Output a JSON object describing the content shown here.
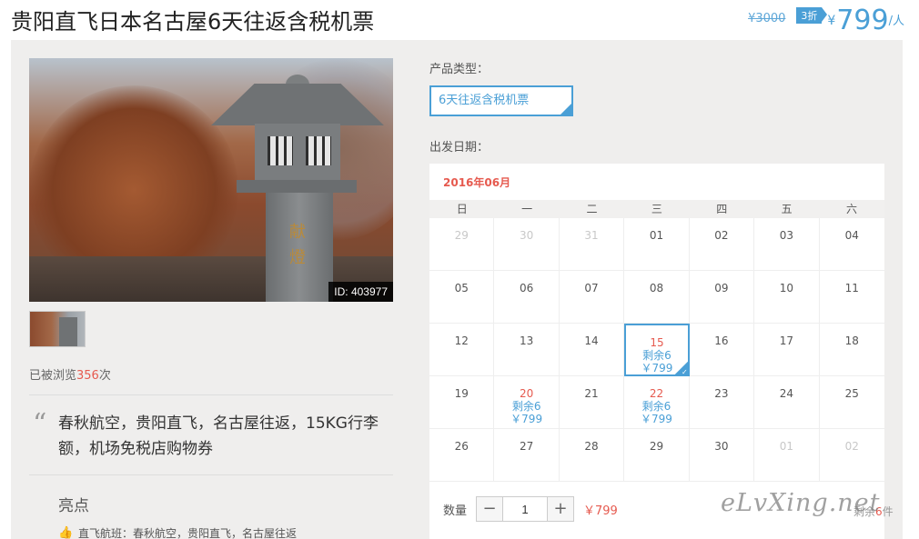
{
  "header": {
    "title": "贵阳直飞日本名古屋6天往返含税机票",
    "old_price": "¥3000",
    "discount": "3折",
    "currency": "¥",
    "price": "799",
    "per_person": "/人"
  },
  "gallery": {
    "photo_id": "ID: 403977",
    "kanji": "献燈"
  },
  "views": {
    "prefix": "已被浏览",
    "count": "356",
    "suffix": "次"
  },
  "quote": {
    "mark": "“",
    "text": "春秋航空，贵阳直飞，名古屋往返，15KG行李额，机场免税店购物券"
  },
  "highlights": {
    "title": "亮点",
    "item": "直飞航班：春秋航空，贵阳直飞，名古屋往返"
  },
  "product": {
    "type_label": "产品类型：",
    "type_value": "6天往返含税机票"
  },
  "calendar": {
    "date_label": "出发日期：",
    "month": "2016年06月",
    "weekdays": [
      "日",
      "一",
      "二",
      "三",
      "四",
      "五",
      "六"
    ],
    "days": [
      {
        "d": "29",
        "other": true
      },
      {
        "d": "30",
        "other": true
      },
      {
        "d": "31",
        "other": true
      },
      {
        "d": "01"
      },
      {
        "d": "02"
      },
      {
        "d": "03"
      },
      {
        "d": "04"
      },
      {
        "d": "05"
      },
      {
        "d": "06"
      },
      {
        "d": "07"
      },
      {
        "d": "08"
      },
      {
        "d": "09"
      },
      {
        "d": "10"
      },
      {
        "d": "11"
      },
      {
        "d": "12"
      },
      {
        "d": "13"
      },
      {
        "d": "14"
      },
      {
        "d": "15",
        "avail": true,
        "selected": true,
        "remain": "剩余6",
        "price": "￥799"
      },
      {
        "d": "16"
      },
      {
        "d": "17"
      },
      {
        "d": "18"
      },
      {
        "d": "19"
      },
      {
        "d": "20",
        "avail": true,
        "remain": "剩余6",
        "price": "￥799"
      },
      {
        "d": "21"
      },
      {
        "d": "22",
        "avail": true,
        "remain": "剩余6",
        "price": "￥799"
      },
      {
        "d": "23"
      },
      {
        "d": "24"
      },
      {
        "d": "25"
      },
      {
        "d": "26"
      },
      {
        "d": "27"
      },
      {
        "d": "28"
      },
      {
        "d": "29"
      },
      {
        "d": "30"
      },
      {
        "d": "01",
        "other": true
      },
      {
        "d": "02",
        "other": true
      }
    ]
  },
  "quantity": {
    "label": "数量",
    "minus": "−",
    "value": "1",
    "plus": "+",
    "price": "￥799",
    "remain_prefix": "剩余",
    "remain_num": "6",
    "remain_suffix": "件"
  },
  "watermark": "eLvXing.net",
  "colors": {
    "accent": "#4a9fd6",
    "highlight": "#e65a4f"
  }
}
